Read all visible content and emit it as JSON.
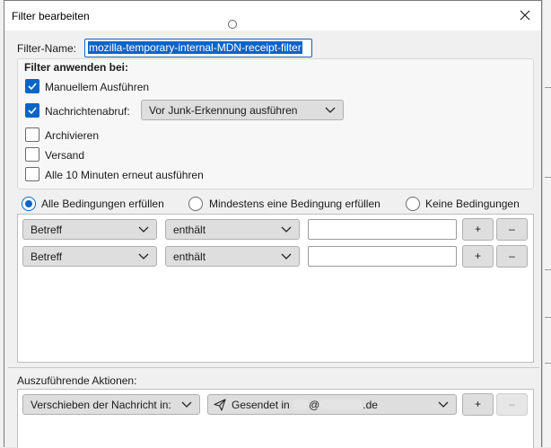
{
  "dialog": {
    "title": "Filter bearbeiten",
    "filter_name_label": "Filter-Name:",
    "filter_name_value": "mozilla-temporary-internal-MDN-receipt-filter"
  },
  "apply": {
    "heading": "Filter anwenden bei:",
    "manual_label": "Manuellem Ausführen",
    "manual_checked": true,
    "fetch_label": "Nachrichtenabruf:",
    "fetch_checked": true,
    "fetch_option": "Vor Junk-Erkennung ausführen",
    "archive_label": "Archivieren",
    "archive_checked": false,
    "send_label": "Versand",
    "send_checked": false,
    "periodic_label": "Alle 10 Minuten erneut ausführen",
    "periodic_checked": false
  },
  "match": {
    "all_label": "Alle Bedingungen erfüllen",
    "any_label": "Mindestens eine Bedingung erfüllen",
    "none_label": "Keine Bedingungen",
    "selected": "all"
  },
  "conditions": [
    {
      "field": "Betreff",
      "operator": "enthält",
      "value": ""
    },
    {
      "field": "Betreff",
      "operator": "enthält",
      "value": ""
    }
  ],
  "buttons": {
    "plus": "+",
    "minus": "–"
  },
  "actions": {
    "heading": "Auszuführende Aktionen:",
    "action": "Verschieben der Nachricht in:",
    "target_prefix": "Gesendet in",
    "target_at": "@",
    "target_suffix": ".de"
  },
  "colors": {
    "accent": "#0a64c8"
  }
}
